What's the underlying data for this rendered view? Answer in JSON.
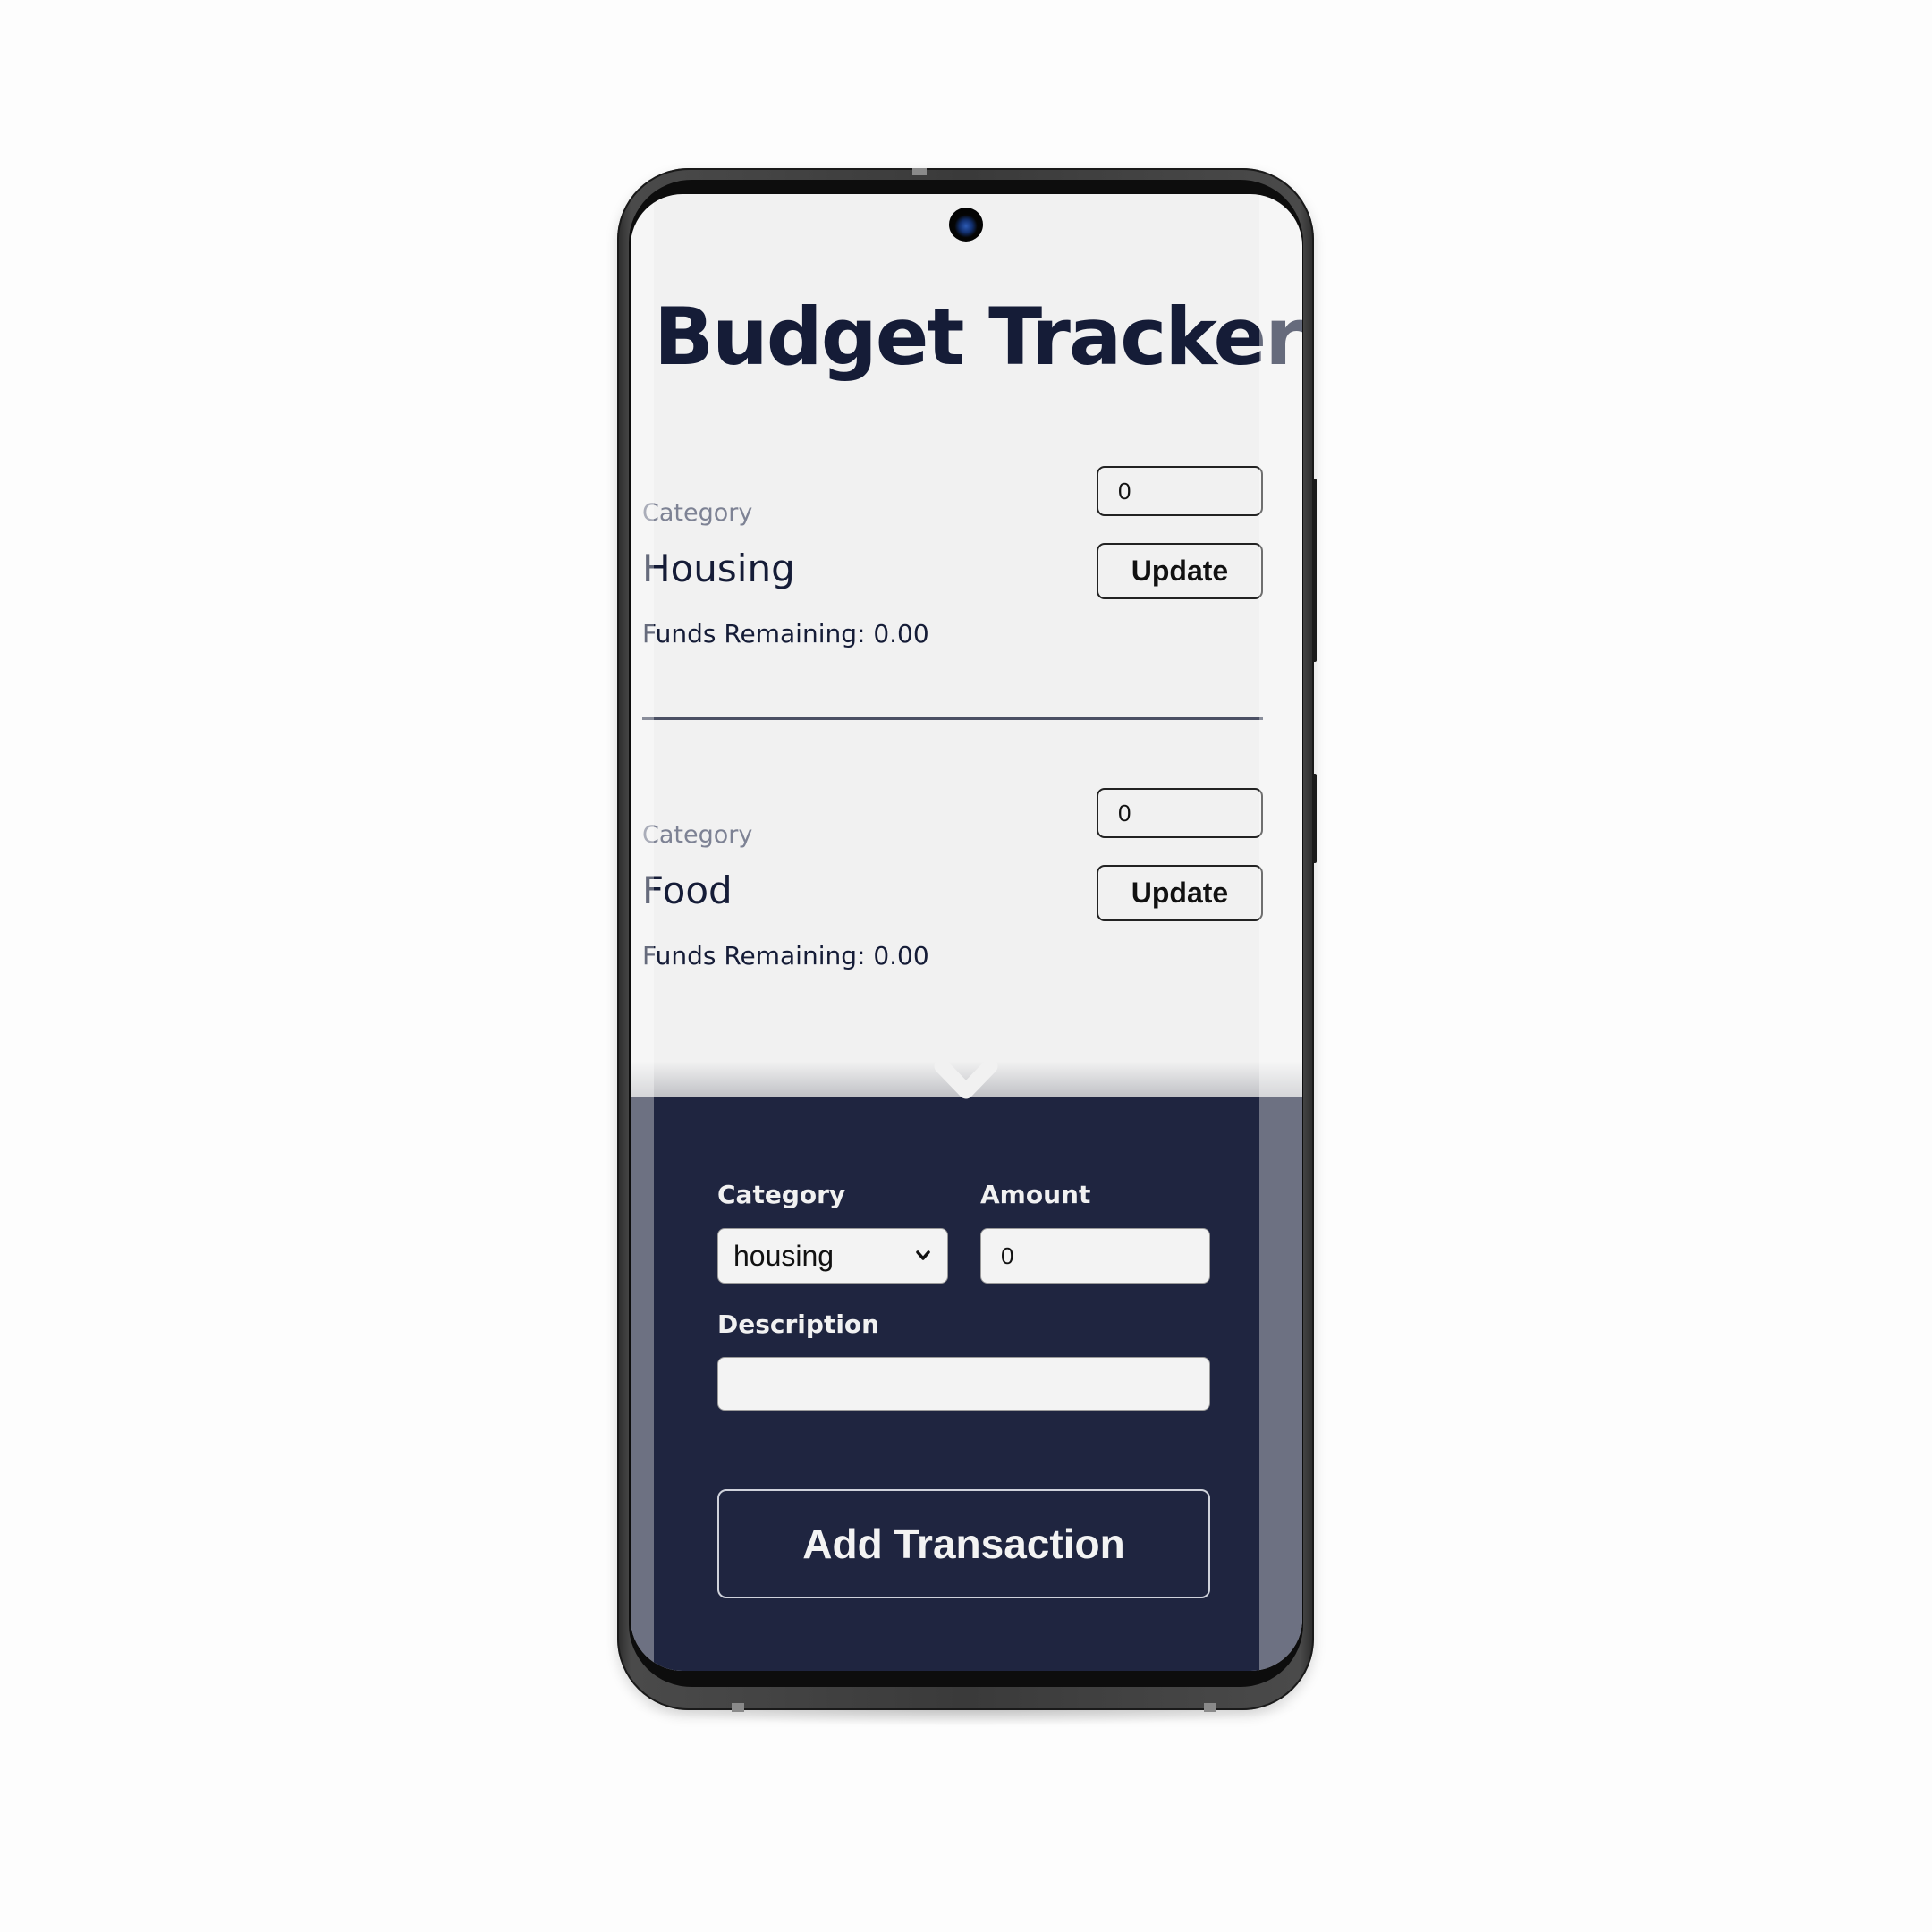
{
  "app": {
    "title": "Budget Tracker"
  },
  "categories": [
    {
      "label": "Category",
      "name": "Housing",
      "budget_value": "0",
      "update_label": "Update",
      "funds_remaining_label": "Funds Remaining: 0.00"
    },
    {
      "label": "Category",
      "name": "Food",
      "budget_value": "0",
      "update_label": "Update",
      "funds_remaining_label": "Funds Remaining: 0.00"
    }
  ],
  "transaction_form": {
    "toggle_icon": "chevron-down-icon",
    "category_label": "Category",
    "category_selected": "housing",
    "amount_label": "Amount",
    "amount_value": "0",
    "description_label": "Description",
    "description_value": "",
    "submit_label": "Add Transaction"
  },
  "colors": {
    "panel_bg": "#1f2540",
    "title_text": "#151c37",
    "page_bg": "#f1f1f1",
    "muted_label": "#7d8294"
  }
}
